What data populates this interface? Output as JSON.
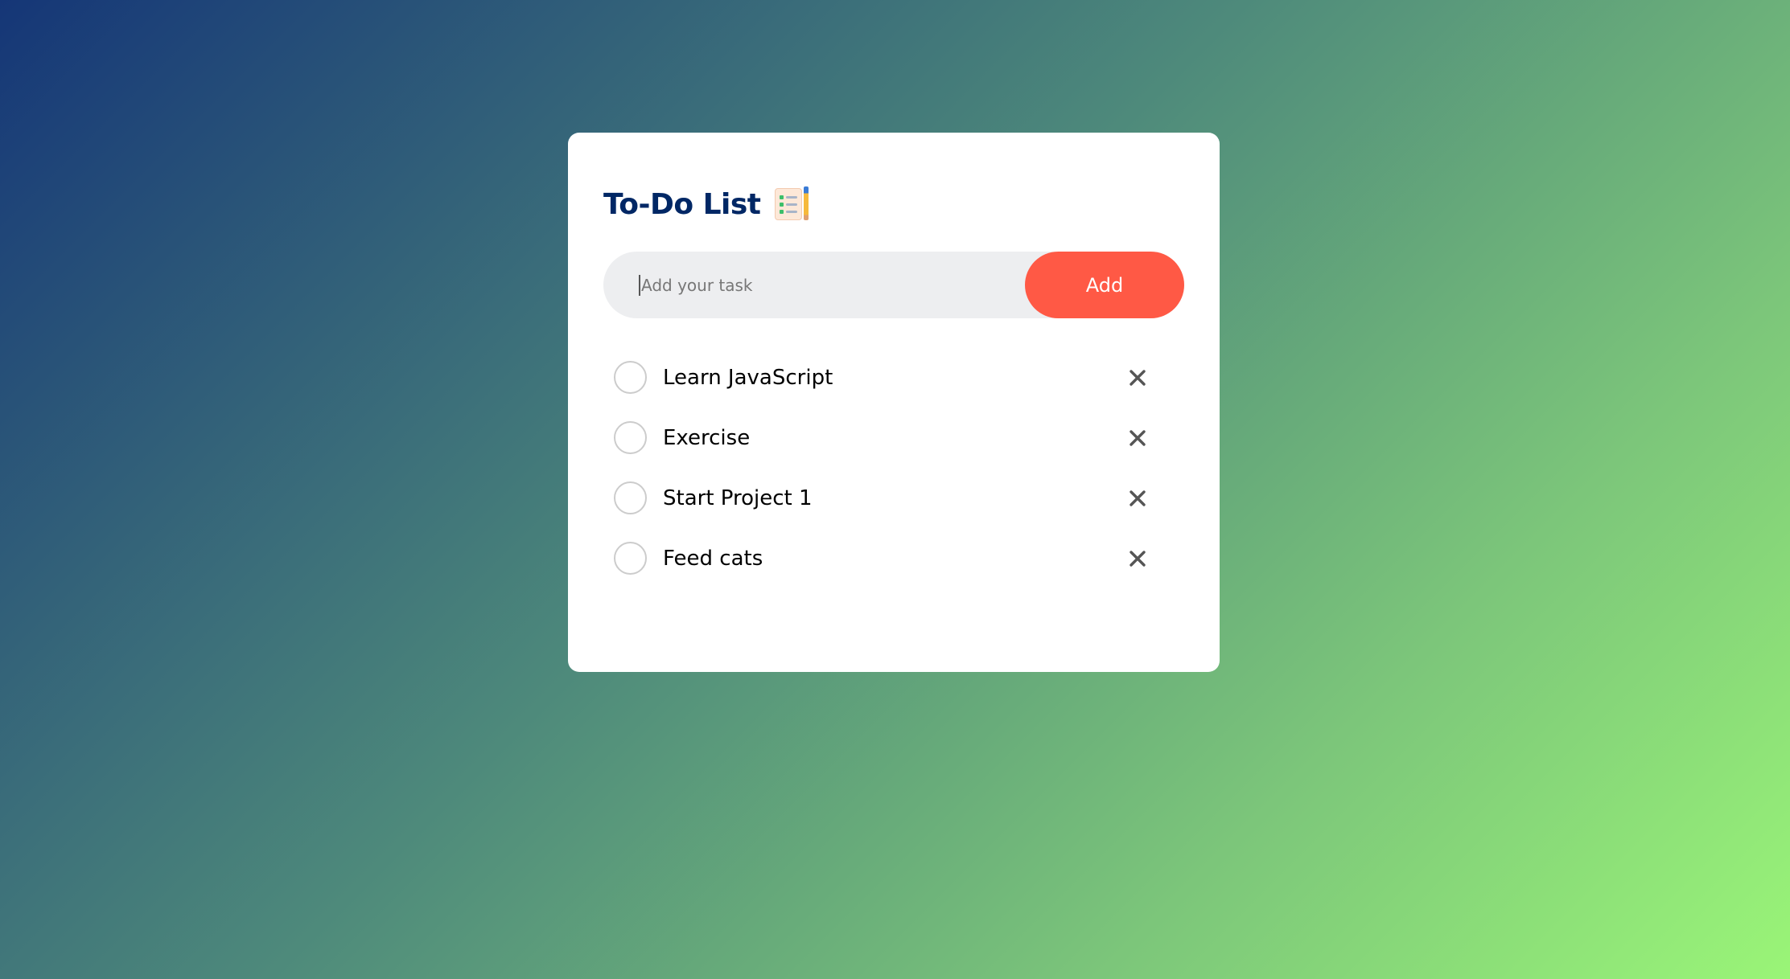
{
  "app": {
    "title": "To-Do List",
    "title_icon": "notepad-pencil-icon"
  },
  "input": {
    "placeholder": "Add your task",
    "value": ""
  },
  "add_button": {
    "label": "Add"
  },
  "tasks": [
    {
      "label": "Learn JavaScript",
      "checked": false,
      "delete_icon": "close-icon"
    },
    {
      "label": "Exercise",
      "checked": false,
      "delete_icon": "close-icon"
    },
    {
      "label": "Start Project 1",
      "checked": false,
      "delete_icon": "close-icon"
    },
    {
      "label": "Feed cats",
      "checked": false,
      "delete_icon": "close-icon"
    }
  ],
  "colors": {
    "gradient_start": "#153677",
    "gradient_end": "#9af577",
    "title": "#002765",
    "accent": "#ff5945",
    "input_bg": "#edeef0",
    "circle_border": "#cccccc",
    "delete_icon": "#555555"
  }
}
